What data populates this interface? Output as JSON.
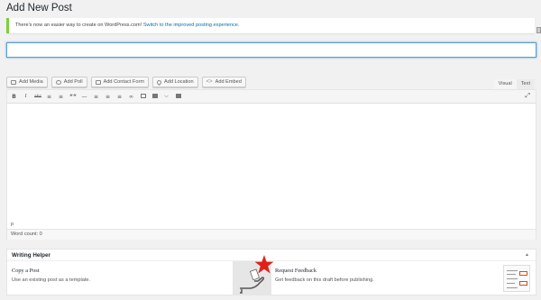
{
  "page_title": "Add New Post",
  "notice": {
    "text": "There's now an easier way to create on WordPress.com!",
    "link": "Switch to the improved posting experience."
  },
  "title_input": {
    "value": "",
    "placeholder": ""
  },
  "media_buttons": [
    {
      "label": "Add Media",
      "icon": "media-icon"
    },
    {
      "label": "Add Poll",
      "icon": "poll-icon"
    },
    {
      "label": "Add Contact Form",
      "icon": "form-icon"
    },
    {
      "label": "Add Location",
      "icon": "location-icon"
    },
    {
      "label": "Add Embed",
      "icon": "embed-icon"
    }
  ],
  "editor_tabs": {
    "visual": "Visual",
    "text": "Text"
  },
  "toolbar": {
    "bold": "B",
    "italic": "I",
    "strike": "abc",
    "quote": "““",
    "hr": "—"
  },
  "editor": {
    "path": "p",
    "word_count": "Word count: 0"
  },
  "writing_helper": {
    "title": "Writing Helper",
    "toggle": "▲",
    "copy": {
      "title": "Copy a Post",
      "desc": "Use an existing post as a template."
    },
    "feedback": {
      "title": "Request Feedback",
      "desc": "Get feedback on this draft before publishing."
    }
  },
  "colors": {
    "accent": "#0073aa",
    "notice_border": "#7ad03a",
    "star": "#e0201a"
  }
}
